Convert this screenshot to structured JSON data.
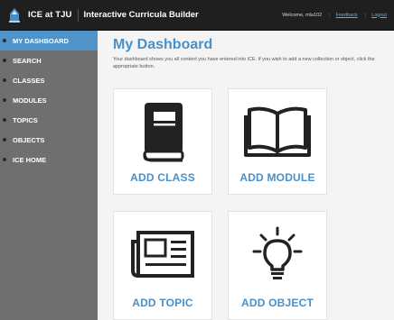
{
  "header": {
    "app_title": "ICE at TJU",
    "app_subtitle": "Interactive Curricula Builder",
    "welcome": "Welcome, mla102",
    "feedback_link": "Feedback",
    "logout_link": "Logout"
  },
  "sidebar": {
    "items": [
      {
        "label": "MY DASHBOARD",
        "icon": "dashboard-icon"
      },
      {
        "label": "SEARCH",
        "icon": "search-icon"
      },
      {
        "label": "CLASSES",
        "icon": "classes-icon"
      },
      {
        "label": "MODULES",
        "icon": "modules-icon"
      },
      {
        "label": "TOPICS",
        "icon": "topics-icon"
      },
      {
        "label": "OBJECTS",
        "icon": "objects-icon"
      },
      {
        "label": "ICE HOME",
        "icon": "home-icon"
      }
    ],
    "active_index": 0
  },
  "main": {
    "title": "My Dashboard",
    "description": "Your dashboard shows you all content you have entered into iCE. If you wish to add a new collection or object, click the appropriate button.",
    "cards": [
      {
        "label": "ADD CLASS",
        "icon": "book-icon"
      },
      {
        "label": "ADD MODULE",
        "icon": "open-book-icon"
      },
      {
        "label": "ADD TOPIC",
        "icon": "newspaper-icon"
      },
      {
        "label": "ADD OBJECT",
        "icon": "lightbulb-icon"
      }
    ]
  },
  "colors": {
    "accent": "#4a90c8",
    "topbar": "#1f1f1f",
    "sidebar": "#6f6f6f",
    "icon": "#222222"
  }
}
